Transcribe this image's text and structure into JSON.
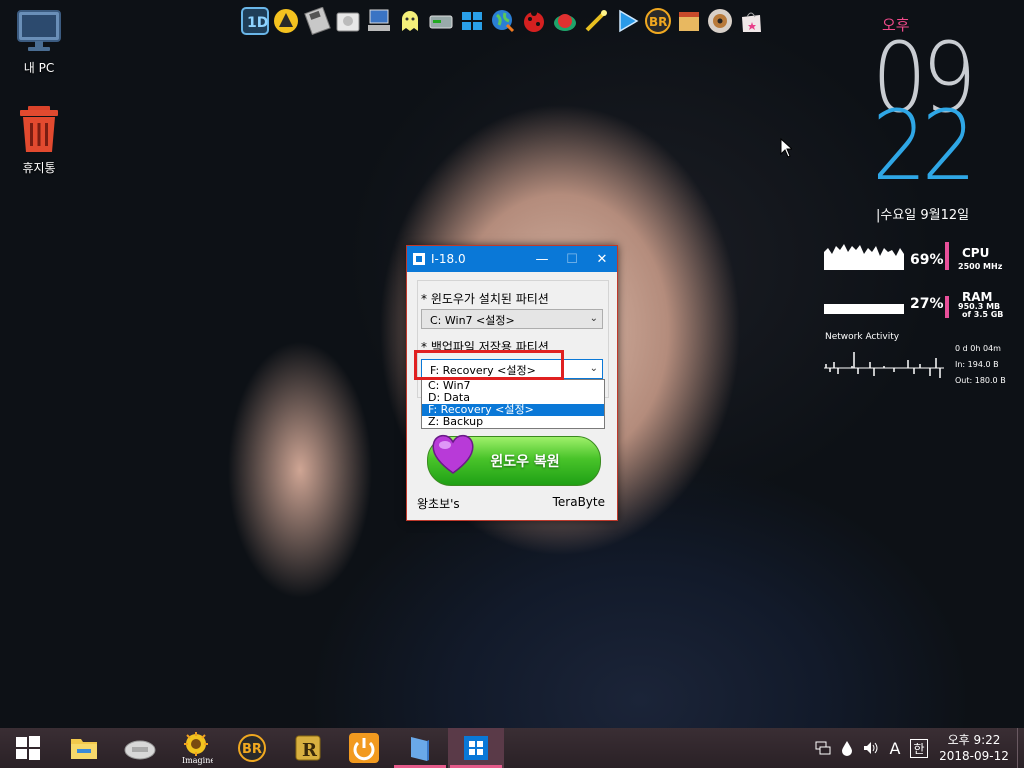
{
  "desktop": {
    "icons": [
      {
        "label": "내 PC",
        "icon": "monitor-icon"
      },
      {
        "label": "휴지통",
        "icon": "recycle-bin-icon"
      }
    ]
  },
  "dock_icons": [
    "app-1d-icon",
    "triangle-a-icon",
    "floppy-icon",
    "disk-drive-icon",
    "computer-icon",
    "ghost-icon",
    "hdd-icon",
    "windows-icon",
    "globe-icon",
    "ladybug-icon",
    "disc-red-icon",
    "wand-icon",
    "play-icon",
    "br-icon",
    "box-icon",
    "dvd-icon",
    "bag-icon"
  ],
  "clock": {
    "ampm": "오후",
    "hour": "09",
    "minute": "22",
    "date": "|수요일 9월12일"
  },
  "cpu": {
    "percent": "69%",
    "name": "CPU",
    "detail": "2500 MHz"
  },
  "ram": {
    "percent": "27%",
    "name": "RAM",
    "detail1": "950.3 MB",
    "detail2": "of  3.5 GB"
  },
  "network": {
    "title": "Network Activity",
    "uptime": "0 d 0h 04m",
    "in": "In: 194.0 B",
    "out": "Out: 180.0 B"
  },
  "dialog": {
    "title": "I-18.0",
    "label_windows": "* 윈도우가 설치된 파티션",
    "combo_windows": "C: Win7  <설정>",
    "label_backup": "* 백업파일 저장용 파티션",
    "combo_backup": "F: Recovery  <설정>",
    "options": [
      "C: Win7",
      "D: Data",
      "F: Recovery  <설정>",
      "Z: Backup"
    ],
    "selected_index": 2,
    "restore_button": "윈도우 복원",
    "footer_left": "왕초보's",
    "footer_right": "TeraByte"
  },
  "taskbar": {
    "items": [
      "start-icon",
      "file-explorer-icon",
      "usb-drive-icon",
      "imagine-icon",
      "br-icon",
      "r-app-icon",
      "power-icon",
      "folder-icon",
      "i18-app-icon"
    ],
    "imagine_label": "Imagine",
    "ime": "A",
    "lang": "한",
    "time": "오후 9:22",
    "date": "2018-09-12"
  },
  "colors": {
    "accent": "#0a78d7",
    "clock_minute": "#2fa7e6",
    "pink": "#e8509a",
    "highlight": "#e02020"
  }
}
